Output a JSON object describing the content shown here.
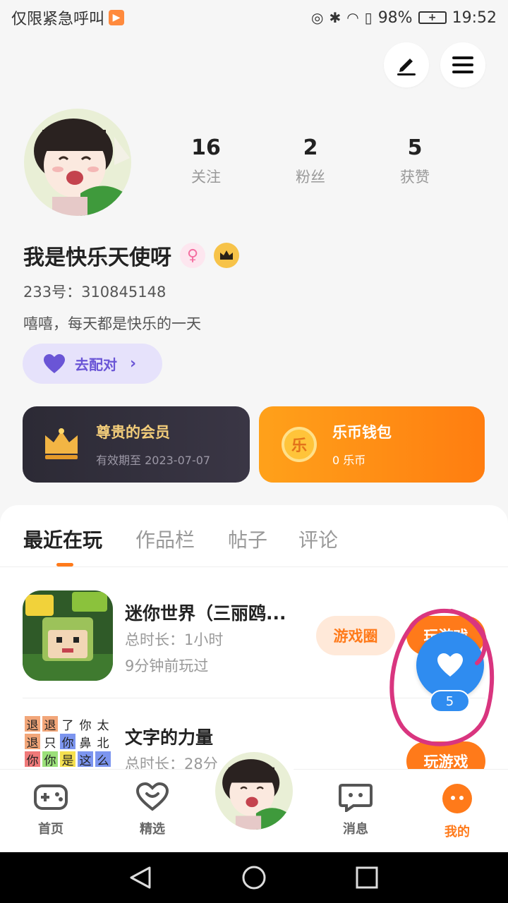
{
  "status_bar": {
    "carrier_text": "仅限紧急呼叫",
    "battery": "98%",
    "time": "19:52"
  },
  "profile": {
    "stats": [
      {
        "value": "16",
        "label": "关注"
      },
      {
        "value": "2",
        "label": "粉丝"
      },
      {
        "value": "5",
        "label": "获赞"
      }
    ],
    "username": "我是快乐天使呀",
    "uid": "233号：310845148",
    "bio": "嘻嘻，每天都是快乐的一天",
    "pair_button": "去配对"
  },
  "cards": {
    "vip": {
      "title": "尊贵的会员",
      "subtitle": "有效期至 2023-07-07"
    },
    "wallet": {
      "title": "乐币钱包",
      "subtitle": "0 乐币",
      "coin_glyph": "乐"
    }
  },
  "tabs": [
    "最近在玩",
    "作品栏",
    "帖子",
    "评论"
  ],
  "games": [
    {
      "name": "迷你世界（三丽鸥...",
      "duration": "总时长：1小时",
      "last_played": "9分钟前玩过",
      "circle_button": "游戏圈",
      "play_button": "玩游戏"
    },
    {
      "name": "文字的力量",
      "duration": "总时长：28分",
      "play_button": "玩游戏"
    }
  ],
  "word_icon_chars": [
    "退",
    "退",
    "了",
    "你",
    "太",
    "退",
    "只",
    "你",
    "鼻",
    "北",
    "你",
    "你",
    "是",
    "这",
    "么"
  ],
  "like_count": "5",
  "bottom_nav": [
    {
      "label": "首页"
    },
    {
      "label": "精选"
    },
    {
      "label": ""
    },
    {
      "label": "消息"
    },
    {
      "label": "我的"
    }
  ],
  "colors": {
    "accent": "#ff7a1a",
    "like_blue": "#2f8cf0",
    "annotation": "#d9357f"
  }
}
